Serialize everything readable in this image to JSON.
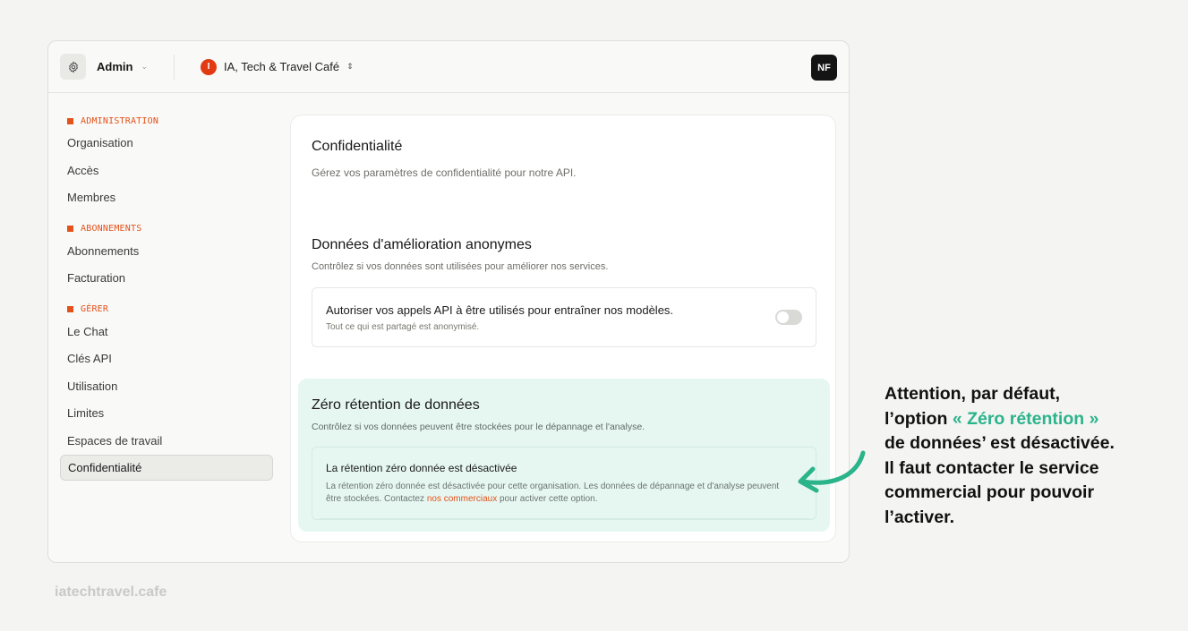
{
  "topbar": {
    "icon": "gear-icon",
    "admin_label": "Admin",
    "admin_chevron": "⌄",
    "org_initial": "I",
    "org_name": "IA, Tech & Travel Café",
    "org_sort": "⇕",
    "avatar": "NF",
    "org_color": "#e23b14"
  },
  "sidebar": {
    "accent": "#e4521b",
    "sections": [
      {
        "heading": "ADMINISTRATION",
        "items": [
          "Organisation",
          "Accès",
          "Membres"
        ]
      },
      {
        "heading": "ABONNEMENTS",
        "items": [
          "Abonnements",
          "Facturation"
        ]
      },
      {
        "heading": "GÉRER",
        "items": [
          "Le Chat",
          "Clés API",
          "Utilisation",
          "Limites",
          "Espaces de travail",
          "Confidentialité"
        ]
      }
    ],
    "active_item": "Confidentialité"
  },
  "main": {
    "title": "Confidentialité",
    "subtitle": "Gérez vos paramètres de confidentialité pour notre API.",
    "anon": {
      "title": "Données d'amélioration anonymes",
      "subtitle": "Contrôlez si vos données sont utilisées pour améliorer nos services.",
      "option_title": "Autoriser vos appels API à être utilisés pour entraîner nos modèles.",
      "option_sub": "Tout ce qui est partagé est anonymisé.",
      "toggle_on": false
    },
    "zero": {
      "title": "Zéro rétention de données",
      "subtitle": "Contrôlez si vos données peuvent être stockées pour le dépannage et l'analyse.",
      "box_title": "La rétention zéro donnée est désactivée",
      "box_text_before": "La rétention zéro donnée est désactivée pour cette organisation. Les données de dépannage et d'analyse peuvent être stockées. Contactez ",
      "box_link": "nos commerciaux",
      "box_text_after": " pour activer cette option.",
      "bg_color": "#e6f7f1"
    }
  },
  "annotation": {
    "line1": "Attention, par défaut,",
    "line2_pre": "l’option ",
    "line2_hl": "« Zéro rétention »",
    "line3": "de données’ est désactivée.",
    "line4": "Il faut contacter le service",
    "line5": "commercial pour pouvoir",
    "line6": "l’activer.",
    "highlight_color": "#2bb38a"
  },
  "footer": {
    "brand": "iatechtravel.cafe"
  }
}
